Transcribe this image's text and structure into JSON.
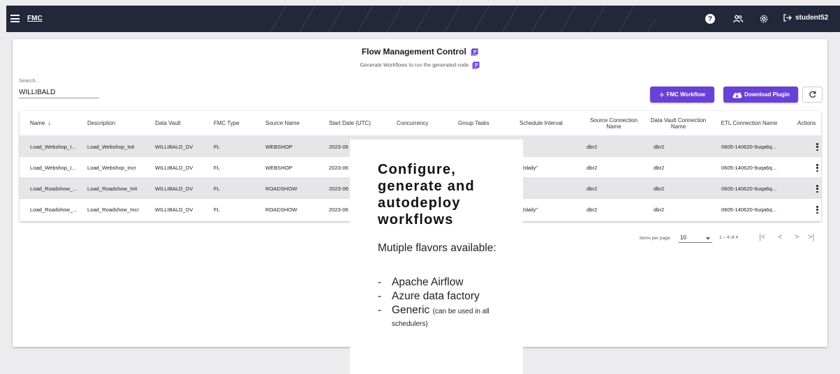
{
  "topbar": {
    "app_title": "FMC",
    "user": "student52"
  },
  "page": {
    "title": "Flow Management Control",
    "subtitle": "Generate Workflows to run the generated code"
  },
  "search": {
    "label": "Search...",
    "value": "WILLIBALD"
  },
  "buttons": {
    "fmc_workflow": "FMC Workflow",
    "download_plugin": "Download Plugin"
  },
  "table": {
    "headers": [
      "Name",
      "Description",
      "Data Vault",
      "FMC Type",
      "Source Name",
      "Start Date (UTC)",
      "Concurrency",
      "Group Tasks",
      "Schedule Interval",
      "Source Connection Name",
      "Data Vault Connection Name",
      "ETL Connection Name",
      "Actions"
    ],
    "rows": [
      {
        "name": "Load_Webshop_I...",
        "description": "Load_Webshop_Init",
        "data_vault": "WILLIBALD_DV",
        "fmc_type": "FL",
        "source_name": "WEBSHOP",
        "start_date": "2023-06",
        "concurrency": "",
        "group_tasks": "",
        "schedule_interval": "",
        "source_connection": "dbr2",
        "dv_connection": "dbr2",
        "etl_connection": "0605-140620-9uqa6q..."
      },
      {
        "name": "Load_Webshop_I...",
        "description": "Load_Webshop_Incr",
        "data_vault": "WILLIBALD_DV",
        "fmc_type": "FL",
        "source_name": "WEBSHOP",
        "start_date": "2023-06",
        "concurrency": "",
        "group_tasks": "",
        "schedule_interval": "@daily\"",
        "source_connection": "dbr2",
        "dv_connection": "dbr2",
        "etl_connection": "0605-140620-9uqa6q..."
      },
      {
        "name": "Load_Roadshow_...",
        "description": "Load_Roadshow_Init",
        "data_vault": "WILLIBALD_DV",
        "fmc_type": "FL",
        "source_name": "ROADSHOW",
        "start_date": "2023-06",
        "concurrency": "",
        "group_tasks": "",
        "schedule_interval": "",
        "source_connection": "dbr2",
        "dv_connection": "dbr2",
        "etl_connection": "0605-140620-9uqa6q..."
      },
      {
        "name": "Load_Roadshow_...",
        "description": "Load_Roadshow_Incr",
        "data_vault": "WILLIBALD_DV",
        "fmc_type": "FL",
        "source_name": "ROADSHOW",
        "start_date": "2023-06",
        "concurrency": "",
        "group_tasks": "",
        "schedule_interval": "@daily\"",
        "source_connection": "dbr2",
        "dv_connection": "dbr2",
        "etl_connection": "0605-140620-9uqa6q..."
      }
    ]
  },
  "pagination": {
    "items_per_page_label": "Items per page:",
    "items_per_page": "10",
    "range": "1 – 4 of 4"
  },
  "overlay": {
    "title": "Configure, generate and autodeploy workflows",
    "subtitle": "Mutiple flavors available:",
    "items": [
      "Apache Airflow",
      "Azure data factory",
      "Generic"
    ],
    "generic_note": "(can be used in all schedulers)"
  },
  "colors": {
    "topbar": "#22273a",
    "accent": "#6941d7",
    "row_alt": "#e6e6e9"
  }
}
